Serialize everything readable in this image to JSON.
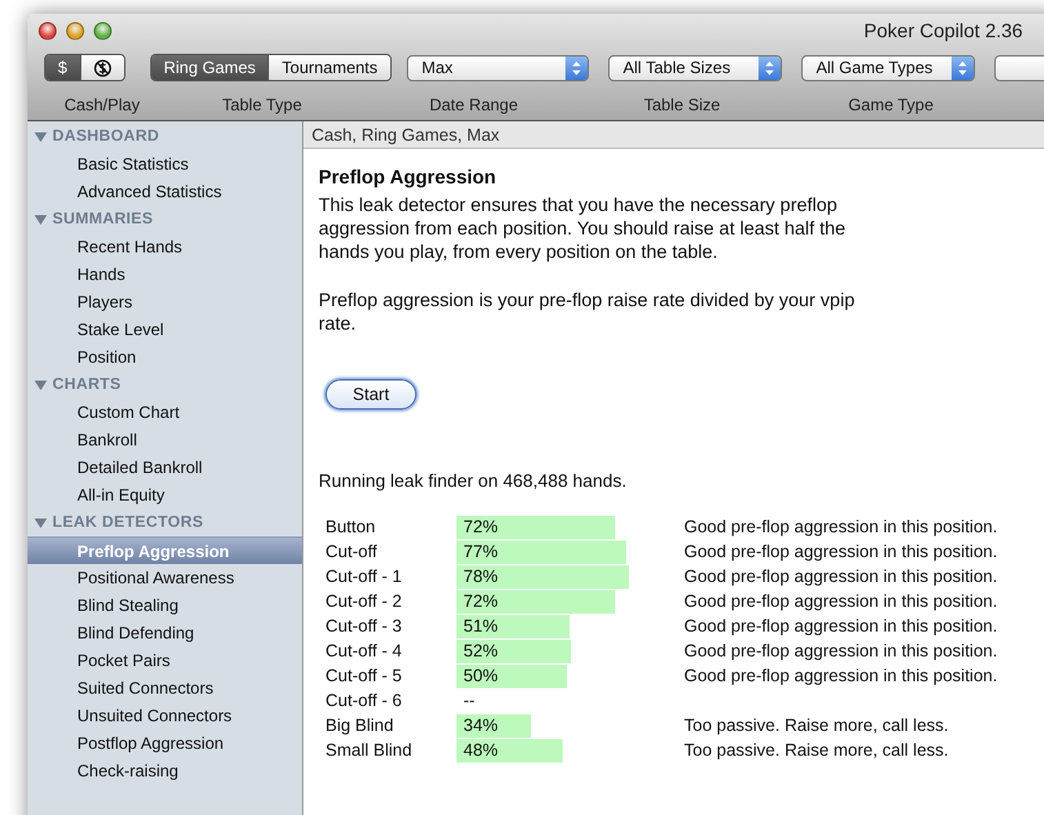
{
  "window": {
    "title": "Poker Copilot 2.36"
  },
  "toolbar": {
    "cash_play": [
      {
        "kind": "text",
        "label": "$",
        "selected": true
      },
      {
        "kind": "icon",
        "selected": false
      }
    ],
    "table_type": [
      {
        "label": "Ring Games",
        "selected": true
      },
      {
        "label": "Tournaments",
        "selected": false
      }
    ],
    "popups": [
      {
        "value": "Max"
      },
      {
        "value": "All Table Sizes"
      },
      {
        "value": "All Game Types"
      }
    ],
    "labels": [
      "Cash/Play",
      "Table Type",
      "Date Range",
      "Table Size",
      "Game Type"
    ]
  },
  "sidebar": [
    {
      "group": "DASHBOARD",
      "expanded": true,
      "items": [
        {
          "label": "Basic Statistics",
          "selected": false
        },
        {
          "label": "Advanced Statistics",
          "selected": false
        }
      ]
    },
    {
      "group": "SUMMARIES",
      "expanded": true,
      "items": [
        {
          "label": "Recent Hands",
          "selected": false
        },
        {
          "label": "Hands",
          "selected": false
        },
        {
          "label": "Players",
          "selected": false
        },
        {
          "label": "Stake Level",
          "selected": false
        },
        {
          "label": "Position",
          "selected": false
        }
      ]
    },
    {
      "group": "CHARTS",
      "expanded": true,
      "items": [
        {
          "label": "Custom Chart",
          "selected": false
        },
        {
          "label": "Bankroll",
          "selected": false
        },
        {
          "label": "Detailed Bankroll",
          "selected": false
        },
        {
          "label": "All-in Equity",
          "selected": false
        }
      ]
    },
    {
      "group": "LEAK DETECTORS",
      "expanded": true,
      "items": [
        {
          "label": "Preflop Aggression",
          "selected": true
        },
        {
          "label": "Positional Awareness",
          "selected": false
        },
        {
          "label": "Blind Stealing",
          "selected": false
        },
        {
          "label": "Blind Defending",
          "selected": false
        },
        {
          "label": "Pocket Pairs",
          "selected": false
        },
        {
          "label": "Suited Connectors",
          "selected": false
        },
        {
          "label": "Unsuited Connectors",
          "selected": false
        },
        {
          "label": "Postflop Aggression",
          "selected": false
        },
        {
          "label": "Check-raising",
          "selected": false
        }
      ]
    }
  ],
  "content": {
    "header": "Cash, Ring Games, Max",
    "title": "Preflop Aggression",
    "paragraphs": [
      "This leak detector ensures that you have the necessary preflop aggression from each position. You should raise at least half the hands you play, from every position on the table.",
      "Preflop aggression is your pre-flop raise rate divided by your vpip rate."
    ],
    "button": "Start",
    "status": "Running leak finder on 468,488 hands.",
    "rows": [
      {
        "position": "Button",
        "value": "72%",
        "assessment": "Good pre-flop aggression in this position."
      },
      {
        "position": "Cut-off",
        "value": "77%",
        "assessment": "Good pre-flop aggression in this position."
      },
      {
        "position": "Cut-off - 1",
        "value": "78%",
        "assessment": "Good pre-flop aggression in this position."
      },
      {
        "position": "Cut-off - 2",
        "value": "72%",
        "assessment": "Good pre-flop aggression in this position."
      },
      {
        "position": "Cut-off - 3",
        "value": "51%",
        "assessment": "Good pre-flop aggression in this position."
      },
      {
        "position": "Cut-off - 4",
        "value": "52%",
        "assessment": "Good pre-flop aggression in this position."
      },
      {
        "position": "Cut-off - 5",
        "value": "50%",
        "assessment": "Good pre-flop aggression in this position."
      },
      {
        "position": "Cut-off - 6",
        "value": "--"
      },
      {
        "position": "Big Blind",
        "value": "34%",
        "assessment": "Too passive. Raise more, call less."
      },
      {
        "position": "Small Blind",
        "value": "48%",
        "assessment": "Too passive. Raise more, call less."
      }
    ]
  }
}
